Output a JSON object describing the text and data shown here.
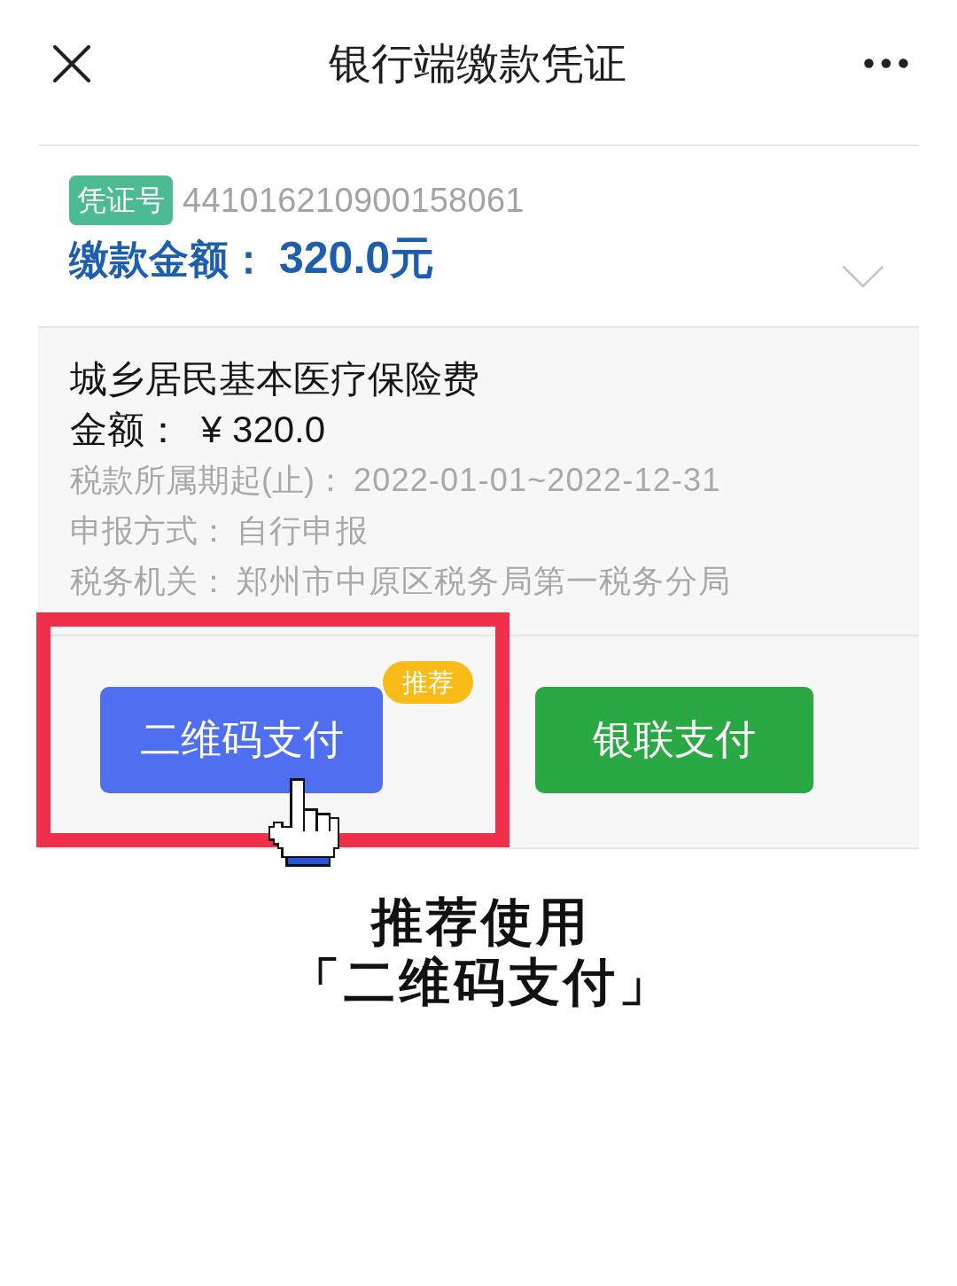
{
  "navbar": {
    "title": "银行端缴款凭证"
  },
  "voucher": {
    "tag": "凭证号",
    "number": "441016210900158061",
    "amount_label": "缴款金额：",
    "amount": "320.0元"
  },
  "tax_item": {
    "name": "城乡居民基本医疗保险费",
    "amount_label": "金额：",
    "amount": "¥ 320.0",
    "details": [
      {
        "label": "税款所属期起(止)：",
        "value": "2022-01-01~2022-12-31"
      },
      {
        "label": "申报方式：",
        "value": "自行申报"
      },
      {
        "label": "税务机关：",
        "value": "郑州市中原区税务局第一税务分局"
      }
    ]
  },
  "payment_buttons": [
    {
      "label": "二维码支付",
      "color": "#4f6ff0",
      "badge": "推荐",
      "highlighted": true
    },
    {
      "label": "银联支付",
      "color": "#29a843",
      "highlighted": false
    }
  ],
  "caption": [
    "推荐使用",
    "「二维码支付」"
  ]
}
